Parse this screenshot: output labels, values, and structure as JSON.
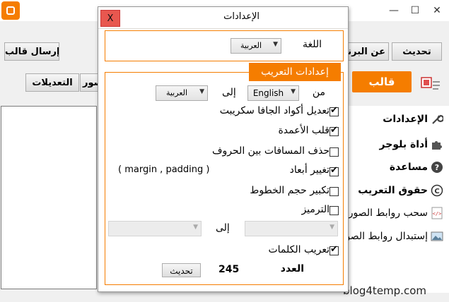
{
  "app": {
    "title": "",
    "window": {
      "minimize": "—",
      "maximize": "☐",
      "close": "✕"
    },
    "toolbar": {
      "send_template": "إرسال قالب",
      "about": "عن البرنامج",
      "update": "تحديث",
      "edits": "التعديلات",
      "images": "صور"
    },
    "template_button": "قالب",
    "sidebar": [
      {
        "label": "الإعدادات",
        "icon": "wrench-icon"
      },
      {
        "label": "أداة بلوجر",
        "icon": "puzzle-icon"
      },
      {
        "label": "مساعدة",
        "icon": "help-icon"
      },
      {
        "label": "حقوق التعريب",
        "icon": "copyright-icon"
      },
      {
        "label": "سحب روابط الصور",
        "icon": "code-file-icon"
      },
      {
        "label": "إستبدال روابط الصور",
        "icon": "image-icon"
      }
    ],
    "footer_url": "blog4temp.com"
  },
  "dialog": {
    "title": "الإعدادات",
    "close_label": "X",
    "language": {
      "label": "اللغة",
      "value": "العربية"
    },
    "localization": {
      "header": "إعدادات التعريب",
      "from_label": "من",
      "from_value": "English",
      "to_label": "إلى",
      "to_value": "العربية",
      "options": [
        {
          "label": "تعديل أكواد الجافا سكريبت",
          "checked": true
        },
        {
          "label": "قلب الأعمدة",
          "checked": true
        },
        {
          "label": "حذف المسافات بين الحروف",
          "checked": false
        },
        {
          "label": "تغيير أبعاد",
          "checked": true,
          "note": "( margin , padding )"
        },
        {
          "label": "تكبير حجم الخطوط",
          "checked": false
        },
        {
          "label": "الترميز",
          "checked": false
        }
      ],
      "encoding_to_label": "إلى",
      "encoding_from_value": "",
      "encoding_to_value": "",
      "translate_words": {
        "label": "تعريب الكلمات",
        "checked": true
      },
      "count_label": "العدد",
      "count_value": "245",
      "update_button": "تحديث"
    }
  }
}
